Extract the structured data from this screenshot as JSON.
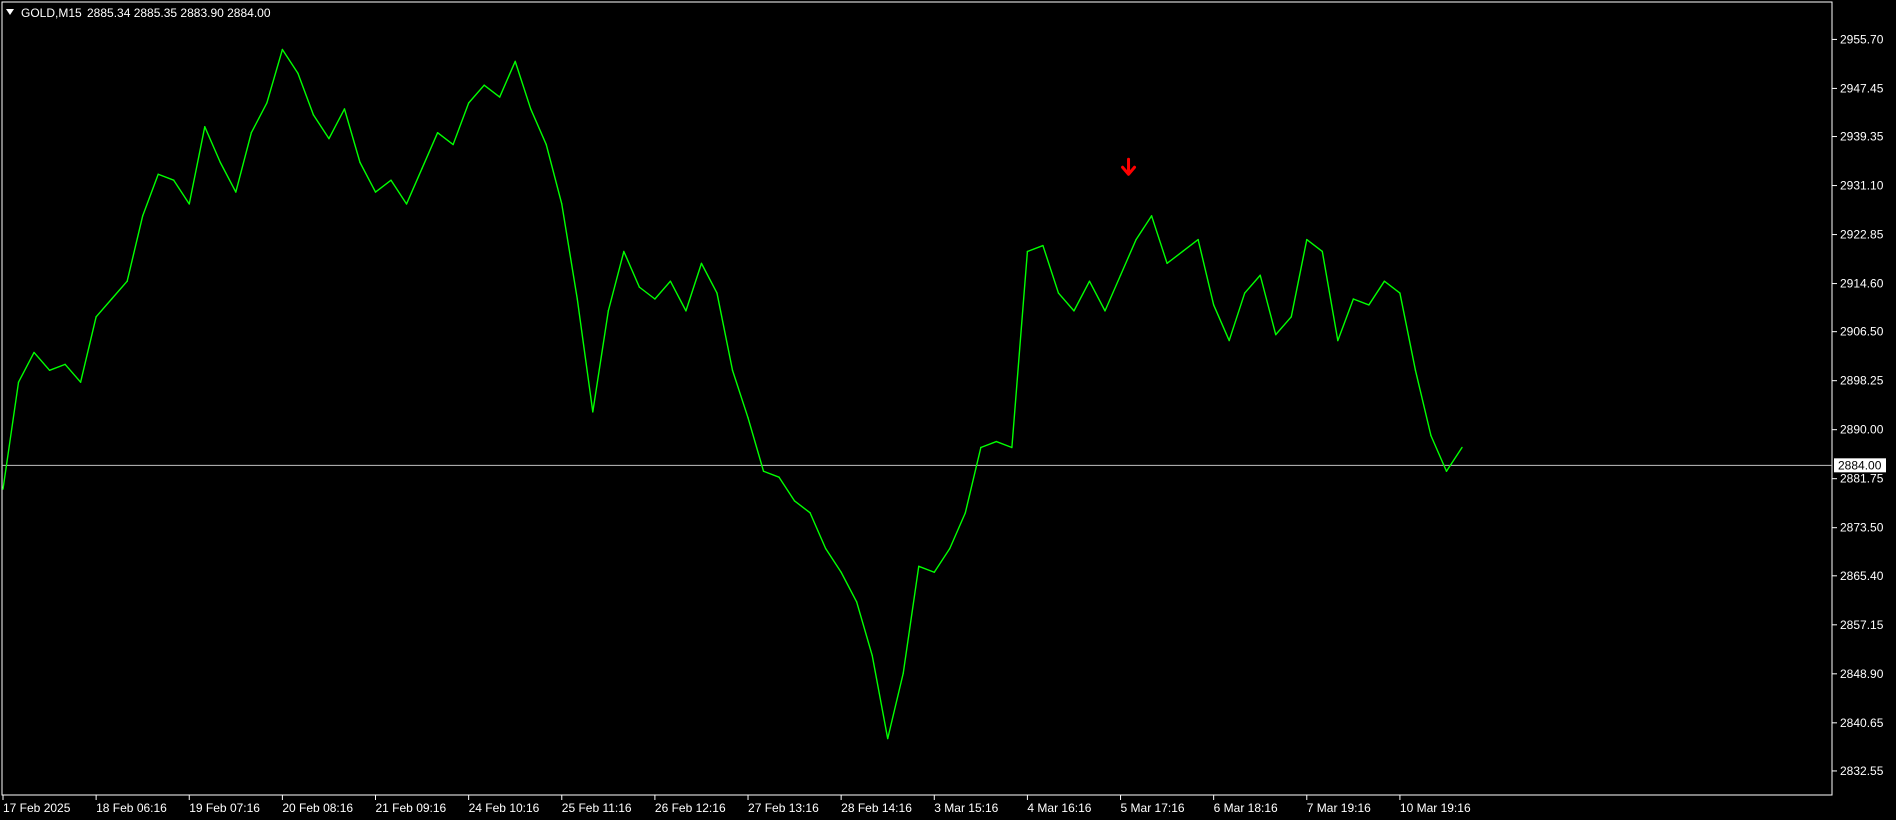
{
  "header": {
    "toggle_icon": "triangle-down-icon",
    "symbol_label": "GOLD,M15",
    "ohlc": "2885.34 2885.35 2883.90 2884.00"
  },
  "price_scale": {
    "ticks": [
      "2955.70",
      "2947.45",
      "2939.35",
      "2931.10",
      "2922.85",
      "2914.60",
      "2906.50",
      "2898.25",
      "2890.00",
      "2881.75",
      "2873.50",
      "2865.40",
      "2857.15",
      "2848.90",
      "2840.65",
      "2832.55"
    ],
    "current_price": "2884.00"
  },
  "time_scale": {
    "ticks": [
      "17 Feb 2025",
      "18 Feb 06:16",
      "19 Feb 07:16",
      "20 Feb 08:16",
      "21 Feb 09:16",
      "24 Feb 10:16",
      "25 Feb 11:16",
      "26 Feb 12:16",
      "27 Feb 13:16",
      "28 Feb 14:16",
      "3 Mar 15:16",
      "4 Mar 16:16",
      "5 Mar 17:16",
      "6 Mar 18:16",
      "7 Mar 19:16",
      "10 Mar 19:16"
    ]
  },
  "colors": {
    "background": "#000000",
    "price_line": "#00ff00",
    "frame": "#ffffff",
    "text": "#ffffff",
    "bid_line": "#c0c0c0",
    "signal_arrow": "#ff0000"
  },
  "signal": {
    "icon": "arrow-down-icon",
    "near_date": "5 Mar 17:16",
    "price": 2932.5
  },
  "chart_data": {
    "type": "line",
    "symbol": "GOLD",
    "timeframe": "M15",
    "ylim": [
      2828.5,
      2962.0
    ],
    "current_price": 2884.0,
    "x": [
      "17 Feb 2025",
      "",
      "",
      "",
      "",
      "",
      "18 Feb 06:16",
      "",
      "",
      "",
      "",
      "",
      "19 Feb 07:16",
      "",
      "",
      "",
      "",
      "",
      "20 Feb 08:16",
      "",
      "",
      "",
      "",
      "",
      "21 Feb 09:16",
      "",
      "",
      "",
      "",
      "",
      "24 Feb 10:16",
      "",
      "",
      "",
      "",
      "",
      "25 Feb 11:16",
      "",
      "",
      "",
      "",
      "",
      "26 Feb 12:16",
      "",
      "",
      "",
      "",
      "",
      "27 Feb 13:16",
      "",
      "",
      "",
      "",
      "",
      "28 Feb 14:16",
      "",
      "",
      "",
      "",
      "",
      "3 Mar 15:16",
      "",
      "",
      "",
      "",
      "",
      "4 Mar 16:16",
      "",
      "",
      "",
      "",
      "",
      "5 Mar 17:16",
      "",
      "",
      "",
      "",
      "",
      "6 Mar 18:16",
      "",
      "",
      "",
      "",
      "",
      "7 Mar 19:16",
      "",
      "",
      "",
      "",
      "",
      "10 Mar 19:16",
      "",
      ""
    ],
    "values": [
      2880,
      2898,
      2903,
      2900,
      2901,
      2898,
      2909,
      2912,
      2915,
      2926,
      2933,
      2932,
      2928,
      2941,
      2935,
      2930,
      2940,
      2945,
      2954,
      2950,
      2943,
      2939,
      2944,
      2935,
      2930,
      2932,
      2928,
      2934,
      2940,
      2938,
      2945,
      2948,
      2946,
      2952,
      2944,
      2938,
      2928,
      2912,
      2893,
      2910,
      2920,
      2914,
      2912,
      2915,
      2910,
      2918,
      2913,
      2900,
      2892,
      2883,
      2882,
      2878,
      2876,
      2870,
      2866,
      2861,
      2852,
      2838,
      2849,
      2867,
      2866,
      2870,
      2876,
      2887,
      2888,
      2887,
      2920,
      2921,
      2913,
      2910,
      2915,
      2910,
      2916,
      2922,
      2926,
      2918,
      2920,
      2922,
      2911,
      2905,
      2913,
      2916,
      2906,
      2909,
      2922,
      2920,
      2905,
      2912,
      2911,
      2915,
      2913,
      2900,
      2889,
      2883,
      2887
    ]
  }
}
